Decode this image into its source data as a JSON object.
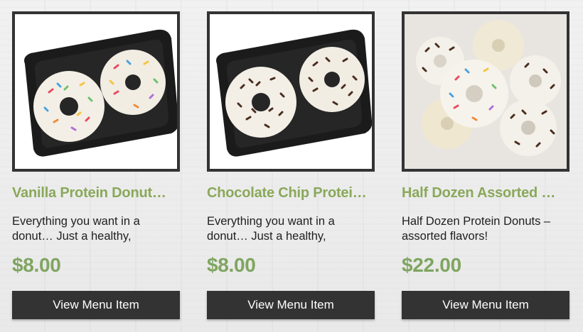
{
  "products": [
    {
      "image_icon": "vanilla-donuts-image",
      "title": "Vanilla Protein Donut…",
      "description": "Everything you want in a donut… Just a healthy,",
      "price": "$8.00",
      "button_label": "View Menu Item"
    },
    {
      "image_icon": "chocolate-chip-donuts-image",
      "title": "Chocolate Chip Protei…",
      "description": "Everything you want in a donut… Just a healthy,",
      "price": "$8.00",
      "button_label": "View Menu Item"
    },
    {
      "image_icon": "assorted-donuts-image",
      "title": "Half Dozen Assorted …",
      "description": "Half Dozen Protein Donuts – assorted flavors!",
      "price": "$22.00",
      "button_label": "View Menu Item"
    }
  ],
  "colors": {
    "title_green": "#8aa85a",
    "price_green": "#7fa560",
    "button_bg": "#333333",
    "frame": "#333333"
  }
}
